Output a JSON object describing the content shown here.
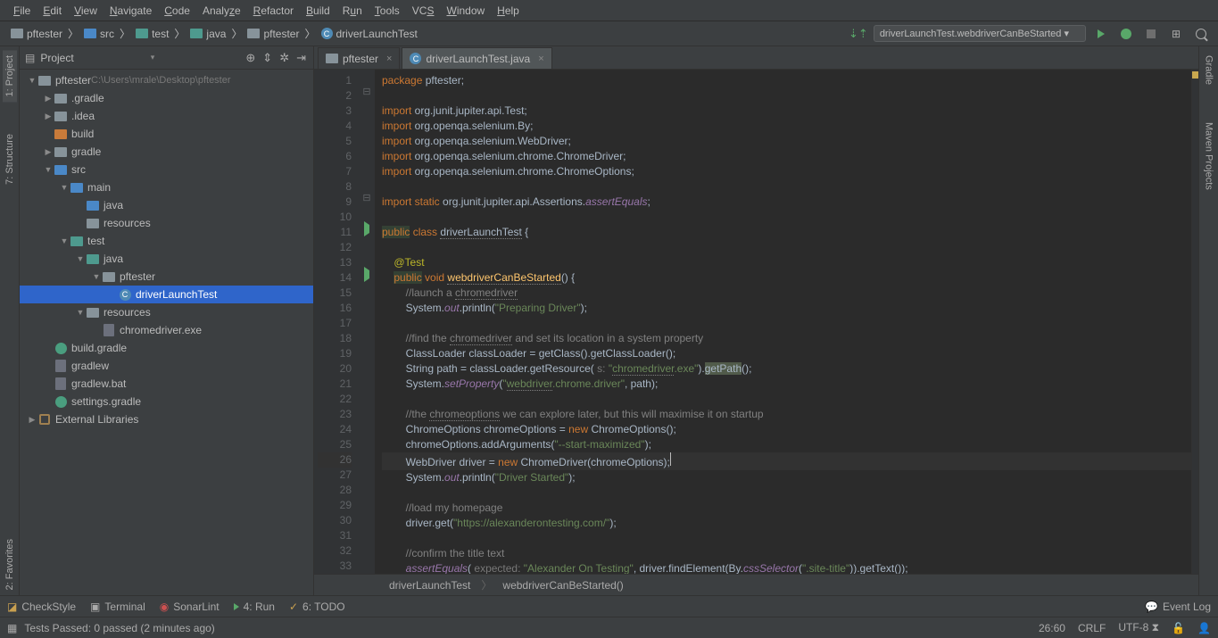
{
  "menu": [
    "File",
    "Edit",
    "View",
    "Navigate",
    "Code",
    "Analyze",
    "Refactor",
    "Build",
    "Run",
    "Tools",
    "VCS",
    "Window",
    "Help"
  ],
  "breadcrumbs": [
    {
      "icon": "folder",
      "label": "pftester"
    },
    {
      "icon": "folder-blue",
      "label": "src"
    },
    {
      "icon": "folder-teal",
      "label": "test"
    },
    {
      "icon": "folder-teal",
      "label": "java"
    },
    {
      "icon": "folder",
      "label": "pftester"
    },
    {
      "icon": "class",
      "label": "driverLaunchTest"
    }
  ],
  "run_config": "driverLaunchTest.webdriverCanBeStarted ▾",
  "sidebar": {
    "title": "Project",
    "tree": [
      {
        "d": 0,
        "arrow": "▼",
        "ic": "folder",
        "lbl": "pftester",
        "extra": "C:\\Users\\mrale\\Desktop\\pftester"
      },
      {
        "d": 1,
        "arrow": "▶",
        "ic": "folder",
        "lbl": ".gradle"
      },
      {
        "d": 1,
        "arrow": "▶",
        "ic": "folder",
        "lbl": ".idea"
      },
      {
        "d": 1,
        "arrow": "",
        "ic": "folder-orange",
        "lbl": "build"
      },
      {
        "d": 1,
        "arrow": "▶",
        "ic": "folder",
        "lbl": "gradle"
      },
      {
        "d": 1,
        "arrow": "▼",
        "ic": "folder-blue",
        "lbl": "src"
      },
      {
        "d": 2,
        "arrow": "▼",
        "ic": "folder-blue",
        "lbl": "main"
      },
      {
        "d": 3,
        "arrow": "",
        "ic": "folder-blue",
        "lbl": "java"
      },
      {
        "d": 3,
        "arrow": "",
        "ic": "folder",
        "lbl": "resources"
      },
      {
        "d": 2,
        "arrow": "▼",
        "ic": "folder-teal",
        "lbl": "test"
      },
      {
        "d": 3,
        "arrow": "▼",
        "ic": "folder-teal",
        "lbl": "java"
      },
      {
        "d": 4,
        "arrow": "▼",
        "ic": "folder",
        "lbl": "pftester"
      },
      {
        "d": 5,
        "arrow": "",
        "ic": "class",
        "lbl": "driverLaunchTest",
        "sel": true
      },
      {
        "d": 3,
        "arrow": "▼",
        "ic": "folder",
        "lbl": "resources"
      },
      {
        "d": 4,
        "arrow": "",
        "ic": "file",
        "lbl": "chromedriver.exe"
      },
      {
        "d": 1,
        "arrow": "",
        "ic": "gradle-f",
        "lbl": "build.gradle"
      },
      {
        "d": 1,
        "arrow": "",
        "ic": "file",
        "lbl": "gradlew"
      },
      {
        "d": 1,
        "arrow": "",
        "ic": "file",
        "lbl": "gradlew.bat"
      },
      {
        "d": 1,
        "arrow": "",
        "ic": "gradle-f",
        "lbl": "settings.gradle"
      },
      {
        "d": 0,
        "arrow": "▶",
        "ic": "lib",
        "lbl": "External Libraries"
      }
    ]
  },
  "tabs": [
    {
      "ic": "folder",
      "label": "pftester",
      "active": false
    },
    {
      "ic": "class",
      "label": "driverLaunchTest.java",
      "active": true
    }
  ],
  "left_tool": [
    "1: Project",
    "7: Structure"
  ],
  "right_tool": [
    "Gradle",
    "Maven Projects"
  ],
  "left_tool_b": "2: Favorites",
  "code_crumbs": [
    "driverLaunchTest",
    "webdriverCanBeStarted()"
  ],
  "bottom": [
    "CheckStyle",
    "Terminal",
    "SonarLint",
    "4: Run",
    "6: TODO"
  ],
  "bottom_right": "Event Log",
  "status": {
    "msg": "Tests Passed: 0 passed (2 minutes ago)",
    "pos": "26:60",
    "eol": "CRLF",
    "enc": "UTF-8"
  },
  "lines": 34,
  "run_marks": {
    "11": "run",
    "14": "run"
  },
  "fold_marks": {
    "2": "⊟",
    "9": "⊟",
    "11": "⊟",
    "14": "⊟"
  }
}
